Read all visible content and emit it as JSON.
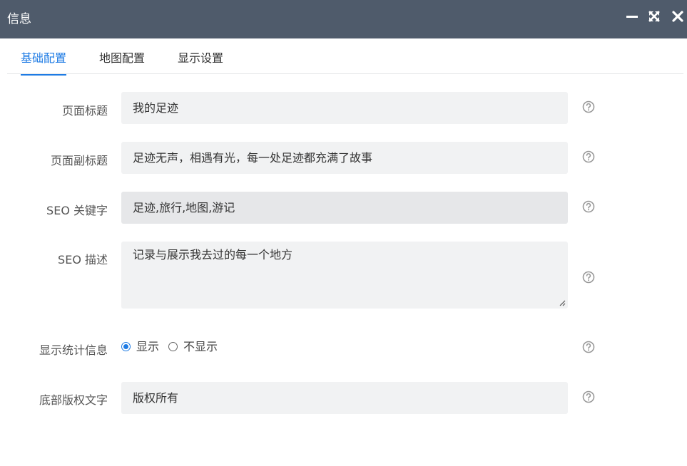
{
  "window": {
    "title": "信息",
    "buttons": [
      {
        "name": "minimize",
        "icon": "minimize-icon"
      },
      {
        "name": "maximize",
        "icon": "maximize-icon"
      },
      {
        "name": "close",
        "icon": "close-icon"
      }
    ]
  },
  "tabs": [
    {
      "label": "基础配置",
      "active": true
    },
    {
      "label": "地图配置",
      "active": false
    },
    {
      "label": "显示设置",
      "active": false
    }
  ],
  "form": {
    "page_title": {
      "label": "页面标题",
      "value": "我的足迹"
    },
    "page_subtitle": {
      "label": "页面副标题",
      "value": "足迹无声，相遇有光，每一处足迹都充满了故事"
    },
    "seo_keywords": {
      "label": "SEO 关键字",
      "value": "足迹,旅行,地图,游记"
    },
    "seo_description": {
      "label": "SEO 描述",
      "value": "记录与展示我去过的每一个地方"
    },
    "show_stats": {
      "label": "显示统计信息",
      "options": [
        "显示",
        "不显示"
      ],
      "selected": "显示"
    },
    "copyright": {
      "label": "底部版权文字",
      "value": "版权所有"
    }
  },
  "colors": {
    "titlebar": "#4f5b6b",
    "accent": "#1e7be4",
    "field_bg": "#f1f2f3"
  },
  "icons": {
    "help": "question-circle-icon"
  }
}
